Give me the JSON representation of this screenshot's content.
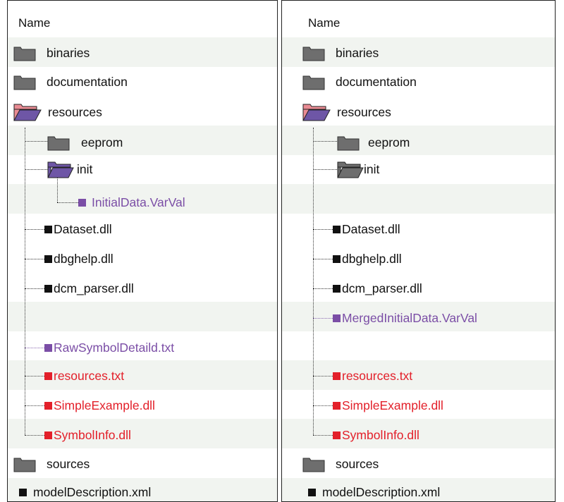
{
  "colors": {
    "purple": "#7b4ea6",
    "red": "#e3202a",
    "black": "#111111",
    "folder_gray": "#6e6e6e",
    "folder_pink": "#e98b93",
    "folder_purple": "#6e56a6"
  },
  "left": {
    "header": "Name",
    "items": {
      "binaries": "binaries",
      "documentation": "documentation",
      "resources": "resources",
      "eeprom": "eeprom",
      "init": "init",
      "initial_data": "InitialData.VarVal",
      "dataset": "Dataset.dll",
      "dbghelp": "dbghelp.dll",
      "dcm_parser": "dcm_parser.dll",
      "raw_symbol": "RawSymbolDetaild.txt",
      "resources_txt": "resources.txt",
      "simple_example": "SimpleExample.dll",
      "symbol_info": "SymbolInfo.dll",
      "sources": "sources",
      "model_description": "modelDescription.xml"
    }
  },
  "right": {
    "header": "Name",
    "items": {
      "binaries": "binaries",
      "documentation": "documentation",
      "resources": "resources",
      "eeprom": "eeprom",
      "init": "init",
      "dataset": "Dataset.dll",
      "dbghelp": "dbghelp.dll",
      "dcm_parser": "dcm_parser.dll",
      "merged": "MergedInitialData.VarVal",
      "resources_txt": "resources.txt",
      "simple_example": "SimpleExample.dll",
      "symbol_info": "SymbolInfo.dll",
      "sources": "sources",
      "model_description": "modelDescription.xml"
    }
  }
}
